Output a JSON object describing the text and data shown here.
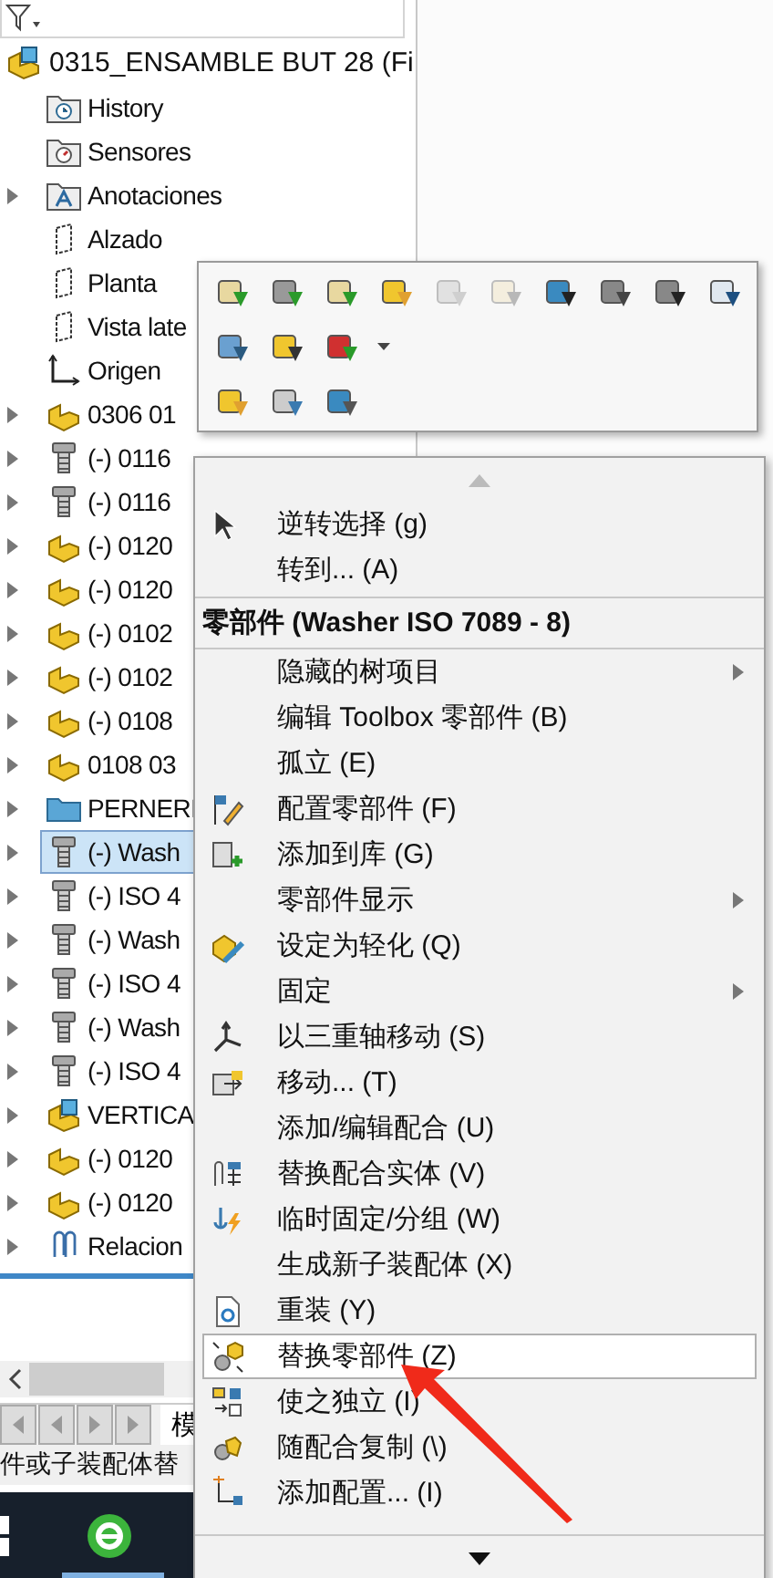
{
  "tree": {
    "root": {
      "label": "0315_ENSAMBLE BUT 28 (Fi",
      "kind": "assembly"
    },
    "items": [
      {
        "label": "History",
        "kind": "history",
        "expandable": false,
        "selected": false
      },
      {
        "label": "Sensores",
        "kind": "sensors",
        "expandable": false,
        "selected": false
      },
      {
        "label": "Anotaciones",
        "kind": "annotations",
        "expandable": true,
        "selected": false
      },
      {
        "label": "Alzado",
        "kind": "plane",
        "expandable": false,
        "selected": false
      },
      {
        "label": "Planta",
        "kind": "plane",
        "expandable": false,
        "selected": false
      },
      {
        "label": "Vista late",
        "kind": "plane",
        "expandable": false,
        "selected": false
      },
      {
        "label": "Origen",
        "kind": "origin",
        "expandable": false,
        "selected": false
      },
      {
        "label": "0306 01",
        "kind": "part",
        "expandable": true,
        "selected": false
      },
      {
        "label": "(-) 0116",
        "kind": "bolt",
        "expandable": true,
        "selected": false
      },
      {
        "label": "(-) 0116",
        "kind": "bolt",
        "expandable": true,
        "selected": false
      },
      {
        "label": "(-) 0120",
        "kind": "part",
        "expandable": true,
        "selected": false
      },
      {
        "label": "(-) 0120",
        "kind": "part",
        "expandable": true,
        "selected": false
      },
      {
        "label": "(-) 0102",
        "kind": "part",
        "expandable": true,
        "selected": false
      },
      {
        "label": "(-) 0102",
        "kind": "part",
        "expandable": true,
        "selected": false
      },
      {
        "label": "(-) 0108",
        "kind": "part",
        "expandable": true,
        "selected": false
      },
      {
        "label": "0108 03",
        "kind": "part",
        "expandable": true,
        "selected": false
      },
      {
        "label": "PERNERI",
        "kind": "folder",
        "expandable": true,
        "selected": false
      },
      {
        "label": "(-) Wash",
        "kind": "bolt",
        "expandable": true,
        "selected": true
      },
      {
        "label": "(-) ISO 4",
        "kind": "bolt",
        "expandable": true,
        "selected": false
      },
      {
        "label": "(-) Wash",
        "kind": "bolt",
        "expandable": true,
        "selected": false
      },
      {
        "label": "(-) ISO 4",
        "kind": "bolt",
        "expandable": true,
        "selected": false
      },
      {
        "label": "(-) Wash",
        "kind": "bolt",
        "expandable": true,
        "selected": false
      },
      {
        "label": "(-) ISO 4",
        "kind": "bolt",
        "expandable": true,
        "selected": false
      },
      {
        "label": "VERTICA",
        "kind": "assembly",
        "expandable": true,
        "selected": false
      },
      {
        "label": "(-) 0120",
        "kind": "part",
        "expandable": true,
        "selected": false
      },
      {
        "label": "(-) 0120",
        "kind": "part",
        "expandable": true,
        "selected": false
      },
      {
        "label": "Relacion",
        "kind": "mates",
        "expandable": true,
        "selected": false
      }
    ]
  },
  "bottom_tabs": [
    {
      "label": "模",
      "selected": true
    }
  ],
  "status_bar": "件或子装配体替",
  "toolbar": {
    "rows": [
      [
        {
          "disabled": false
        },
        {
          "disabled": false
        },
        {
          "disabled": false
        },
        {
          "disabled": false
        },
        {
          "disabled": true
        },
        {
          "disabled": true
        },
        {
          "disabled": false
        },
        {
          "disabled": false
        },
        {
          "disabled": false
        },
        {
          "disabled": false
        }
      ],
      [
        {
          "disabled": false
        },
        {
          "disabled": false
        },
        {
          "disabled": false
        }
      ],
      [
        {
          "disabled": false
        },
        {
          "disabled": false
        },
        {
          "disabled": false
        }
      ]
    ]
  },
  "menu": {
    "top_items": [
      {
        "label": "逆转选择 (g)",
        "submenu": false,
        "selected": false
      },
      {
        "label": "转到... (A)",
        "submenu": false,
        "selected": false
      }
    ],
    "header": "零部件 (Washer ISO 7089 - 8)",
    "items": [
      {
        "label": "隐藏的树项目",
        "submenu": true,
        "selected": false
      },
      {
        "label": "编辑 Toolbox 零部件 (B)",
        "submenu": false,
        "selected": false
      },
      {
        "label": "孤立 (E)",
        "submenu": false,
        "selected": false
      },
      {
        "label": "配置零部件 (F)",
        "submenu": false,
        "selected": false
      },
      {
        "label": "添加到库 (G)",
        "submenu": false,
        "selected": false
      },
      {
        "label": "零部件显示",
        "submenu": true,
        "selected": false
      },
      {
        "label": "设定为轻化 (Q)",
        "submenu": false,
        "selected": false
      },
      {
        "label": "固定",
        "submenu": true,
        "selected": false
      },
      {
        "label": "以三重轴移动 (S)",
        "submenu": false,
        "selected": false
      },
      {
        "label": "移动... (T)",
        "submenu": false,
        "selected": false
      },
      {
        "label": "添加/编辑配合 (U)",
        "submenu": false,
        "selected": false
      },
      {
        "label": "替换配合实体 (V)",
        "submenu": false,
        "selected": false
      },
      {
        "label": "临时固定/分组 (W)",
        "submenu": false,
        "selected": false
      },
      {
        "label": "生成新子装配体 (X)",
        "submenu": false,
        "selected": false
      },
      {
        "label": "重装 (Y)",
        "submenu": false,
        "selected": false
      },
      {
        "label": "替换零部件 (Z)",
        "submenu": false,
        "selected": true
      },
      {
        "label": "使之独立 (I)",
        "submenu": false,
        "selected": false
      },
      {
        "label": "随配合复制 (\\)",
        "submenu": false,
        "selected": false
      },
      {
        "label": "添加配置... (I)",
        "submenu": false,
        "selected": false
      }
    ]
  }
}
